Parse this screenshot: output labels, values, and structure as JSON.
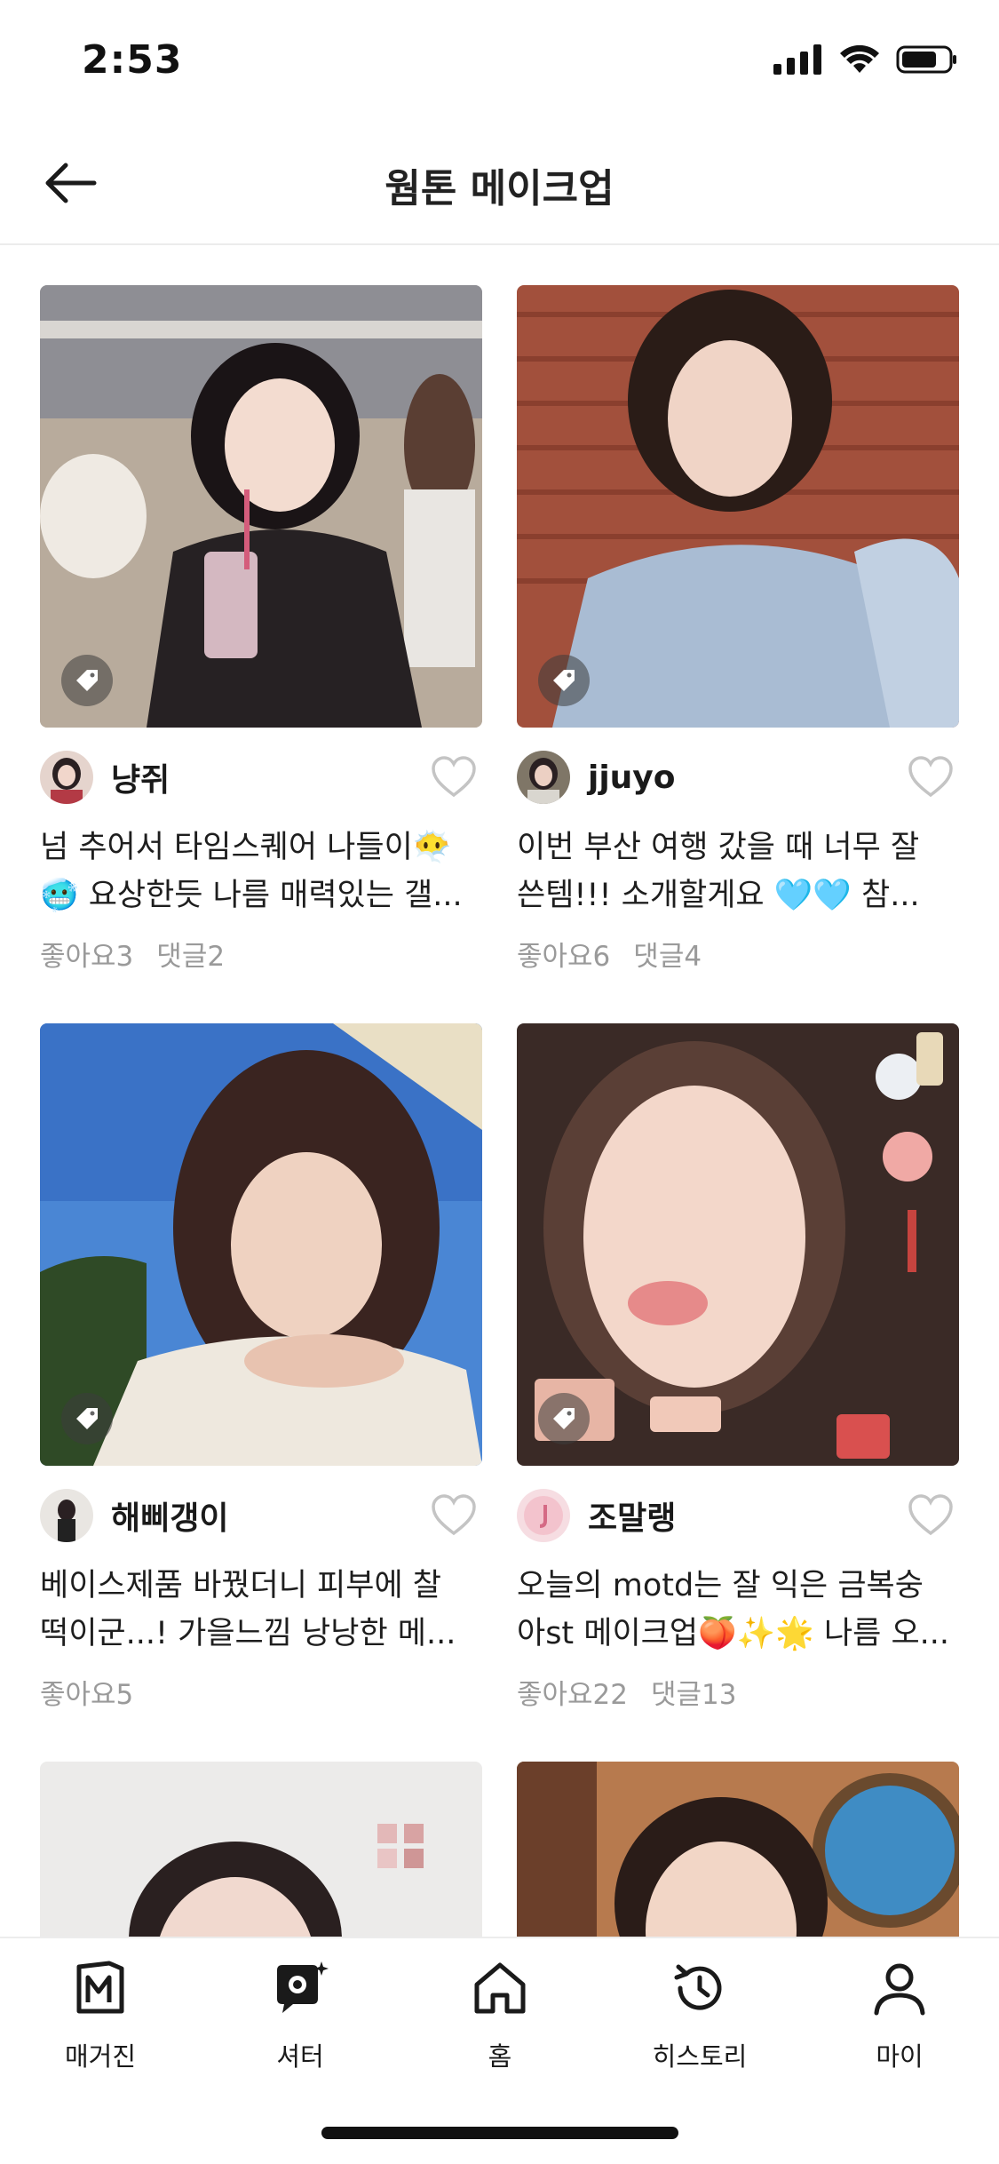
{
  "status_bar": {
    "time": "2:53"
  },
  "header": {
    "title": "웜톤 메이크업"
  },
  "posts": [
    {
      "author": "냥쥐",
      "line1": "넘 추어서 타임스퀘어 나들이😶‍🌫️",
      "line2": "🥶 요상한듯 나름 매력있는 갤...",
      "likes": "좋아요3",
      "comments": "댓글2"
    },
    {
      "author": "jjuyo",
      "line1": "이번 부산 여행 갔을 때 너무 잘",
      "line2": "쓴템!!! 소개할게요 🩵🩵 참...",
      "likes": "좋아요6",
      "comments": "댓글4"
    },
    {
      "author": "해삐갱이",
      "line1": "베이스제품 바꿨더니 피부에 찰",
      "line2": "떡이군...! 가을느낌 낭낭한 메...",
      "likes": "좋아요5",
      "comments": ""
    },
    {
      "author": "조말랭",
      "line1": "오늘의 motd는 잘 익은 금복숭",
      "line2": "아st 메이크업🍑✨🌟 나름 오...",
      "likes": "좋아요22",
      "comments": "댓글13"
    }
  ],
  "tabs": [
    {
      "label": "매거진",
      "icon": "magazine-icon"
    },
    {
      "label": "셔터",
      "icon": "shutter-icon"
    },
    {
      "label": "홈",
      "icon": "home-icon"
    },
    {
      "label": "히스토리",
      "icon": "history-icon"
    },
    {
      "label": "마이",
      "icon": "profile-icon"
    }
  ],
  "colors": {
    "muted_text": "#9a9a9a",
    "divider": "#ececec"
  }
}
